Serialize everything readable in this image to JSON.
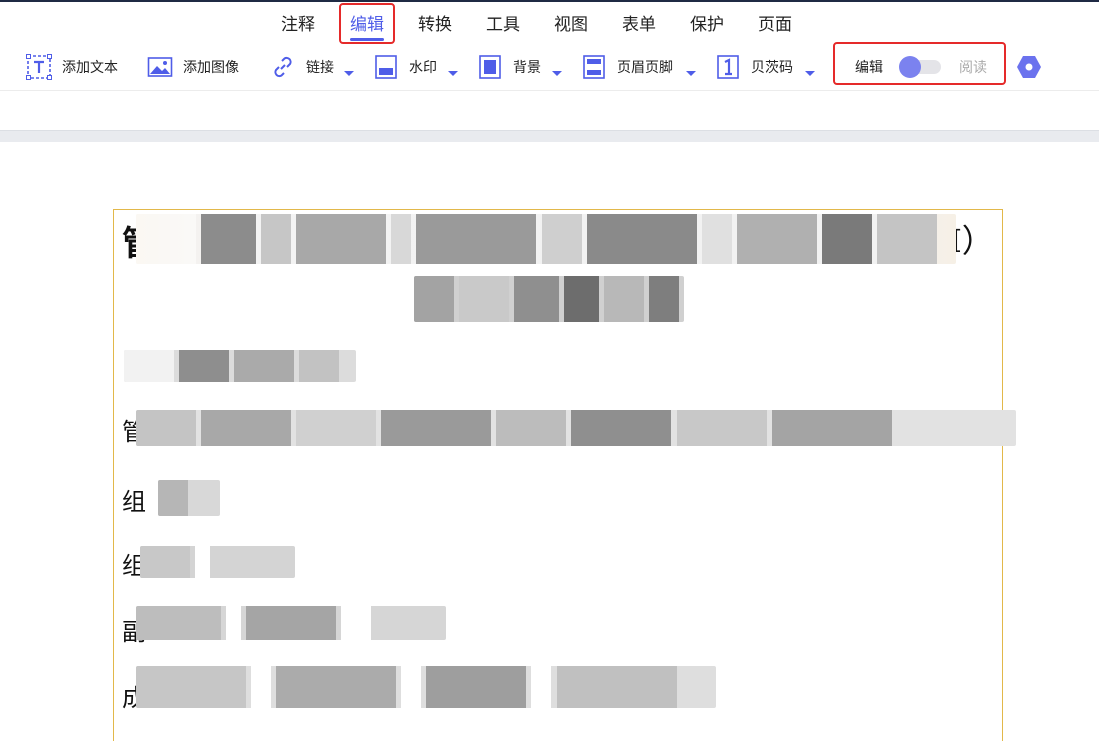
{
  "menu": {
    "tabs": [
      "注释",
      "编辑",
      "转换",
      "工具",
      "视图",
      "表单",
      "保护",
      "页面"
    ],
    "active_index": 1
  },
  "toolbar": {
    "add_text": "添加文本",
    "add_image": "添加图像",
    "link": "链接",
    "watermark": "水印",
    "background": "背景",
    "header_footer": "页眉页脚",
    "page_number": "贝茨码",
    "mode_edit": "编辑",
    "mode_read": "阅读"
  },
  "document": {
    "title_start": "管",
    "title_end": "M）",
    "line_prefixes": [
      "管",
      "组",
      "组",
      "副",
      "成"
    ]
  },
  "colors": {
    "accent": "#4f5de8",
    "highlight_red": "#e52a2a",
    "doc_border": "#e2b84a"
  },
  "icons": {
    "add_text": "text-box-icon",
    "add_image": "image-icon",
    "link": "link-icon",
    "watermark": "watermark-icon",
    "background": "background-icon",
    "header_footer": "header-footer-icon",
    "page_number": "page-number-icon",
    "settings": "hexagon-settings-icon"
  }
}
